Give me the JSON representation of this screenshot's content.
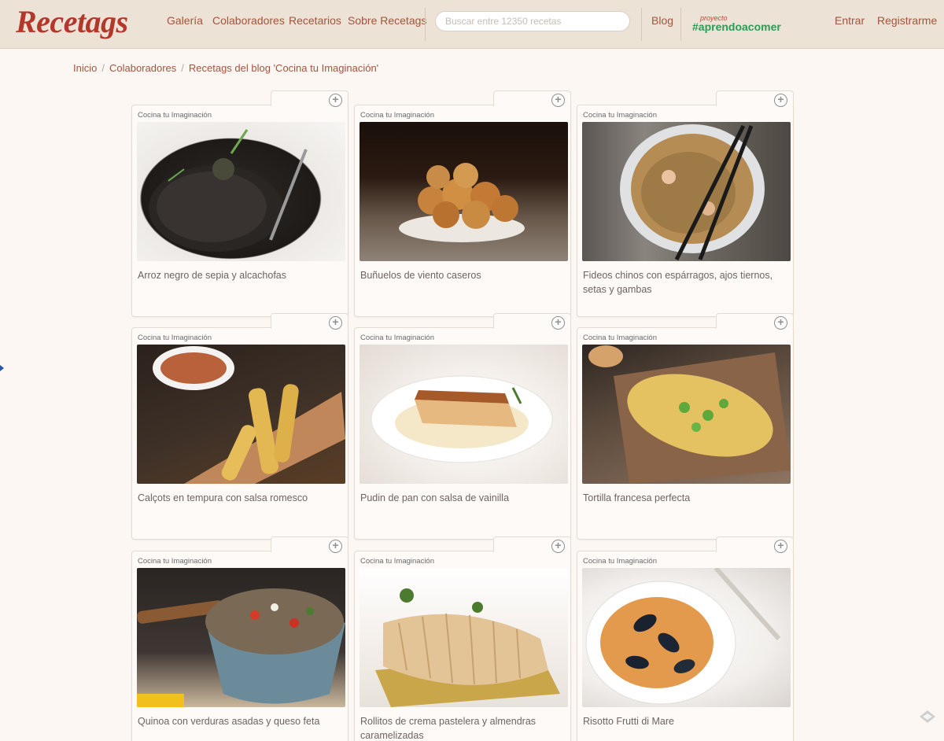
{
  "header": {
    "logo": "Recetags",
    "nav": [
      "Galería",
      "Colaboradores",
      "Recetarios",
      "Sobre Recetags"
    ],
    "search_placeholder": "Buscar entre 12350 recetas",
    "blog": "Blog",
    "proyecto_small": "proyecto",
    "proyecto_tag": "#aprendoacomer",
    "login": "Entrar",
    "register": "Registrarme"
  },
  "breadcrumb": [
    "Inicio",
    "Colaboradores",
    "Recetags del blog 'Cocina tu Imaginación'"
  ],
  "cards": [
    {
      "source": "Cocina tu Imaginación",
      "title": "Arroz negro de sepia y alcachofas"
    },
    {
      "source": "Cocina tu Imaginación",
      "title": "Buñuelos de viento caseros"
    },
    {
      "source": "Cocina tu Imaginación",
      "title": "Fideos chinos con espárragos, ajos tiernos, setas y gambas"
    },
    {
      "source": "Cocina tu Imaginación",
      "title": "Calçots en tempura con salsa romesco"
    },
    {
      "source": "Cocina tu Imaginación",
      "title": "Pudin de pan con salsa de vainilla"
    },
    {
      "source": "Cocina tu Imaginación",
      "title": "Tortilla francesa perfecta"
    },
    {
      "source": "Cocina tu Imaginación",
      "title": "Quinoa con verduras asadas y queso feta"
    },
    {
      "source": "Cocina tu Imaginación",
      "title": "Rollitos de crema pastelera y almendras caramelizadas"
    },
    {
      "source": "Cocina tu Imaginación",
      "title": "Risotto Frutti di Mare"
    }
  ],
  "colors": {
    "header_bg": "#ece2d5",
    "logo": "#b5362a",
    "link": "#a2553d",
    "proyecto_green": "#2a9d56"
  }
}
